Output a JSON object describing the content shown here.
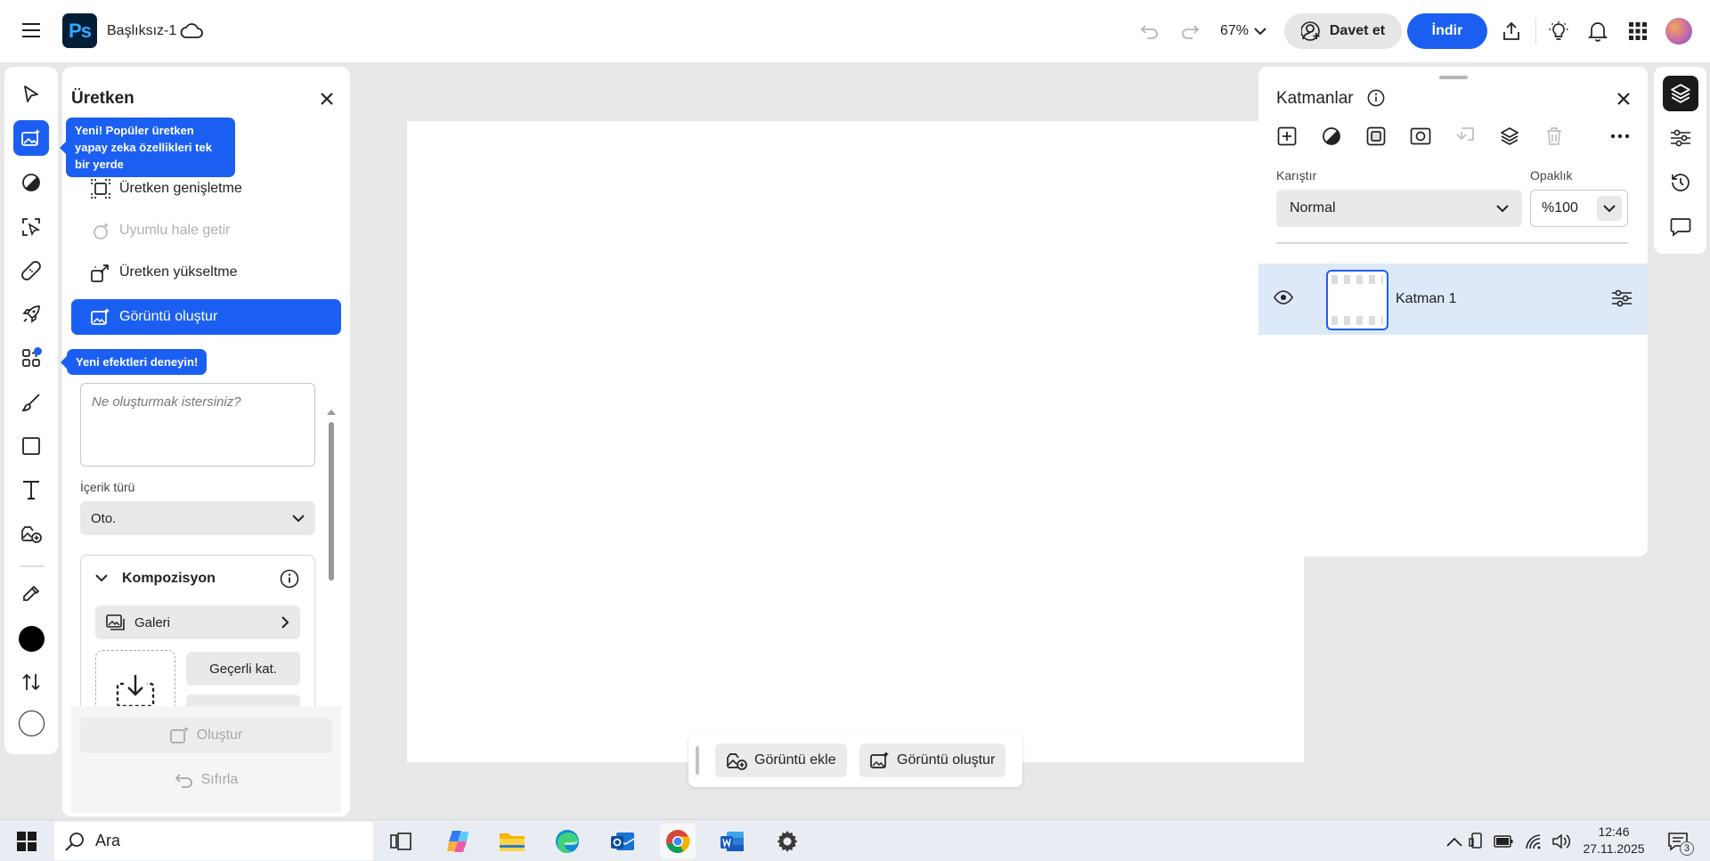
{
  "topbar": {
    "app_logo": "Ps",
    "document_title": "Başlıksız-1",
    "zoom": "67%",
    "invite_label": "Davet et",
    "download_label": "İndir",
    "icons": [
      "menu-icon",
      "cloud-icon",
      "undo-icon",
      "redo-icon",
      "chevron-down-icon",
      "share-icon",
      "lightbulb-icon",
      "bell-icon",
      "apps-grid-icon"
    ]
  },
  "toolbar": {
    "tools": [
      "move-tool",
      "generative-tool",
      "adjust-tool",
      "select-tool",
      "heal-tool",
      "quick-actions-tool",
      "effects-tool",
      "brush-tool",
      "shape-tool",
      "text-tool",
      "add-image-tool",
      "eyedropper-tool",
      "foreground-color",
      "swap-colors",
      "background-color"
    ],
    "tooltip_generative": "Yeni! Popüler üretken yapay zeka özellikleri tek bir yerde",
    "tooltip_effects": "Yeni efektleri deneyin!"
  },
  "generative_panel": {
    "title": "Üretken",
    "items": [
      {
        "label": "Üretken genişletme",
        "state": "normal"
      },
      {
        "label": "Uyumlu hale getir",
        "state": "disabled"
      },
      {
        "label": "Üretken yükseltme",
        "state": "normal"
      },
      {
        "label": "Görüntü oluştur",
        "state": "active"
      }
    ],
    "prompt_placeholder": "Ne oluşturmak istersiniz?",
    "content_type_label": "İçerik türü",
    "content_type_value": "Oto.",
    "composition_title": "Kompozisyon",
    "gallery_label": "Galeri",
    "current_layer_label": "Geçerli kat.",
    "generate_label": "Oluştur",
    "reset_label": "Sıfırla"
  },
  "canvas_bar": {
    "add_image_label": "Görüntü ekle",
    "generate_image_label": "Görüntü oluştur"
  },
  "layers_panel": {
    "title": "Katmanlar",
    "blend_label": "Karıştır",
    "blend_value": "Normal",
    "opacity_label": "Opaklık",
    "opacity_value": "%100",
    "layers": [
      {
        "name": "Katman 1",
        "visible": true,
        "selected": true
      }
    ]
  },
  "taskbar": {
    "search_label": "Ara",
    "time": "12:46",
    "date": "27.11.2025",
    "notification_count": "3"
  },
  "colors": {
    "accent": "#1b5ff2",
    "foreground": "#000000",
    "background": "#ffffff"
  }
}
